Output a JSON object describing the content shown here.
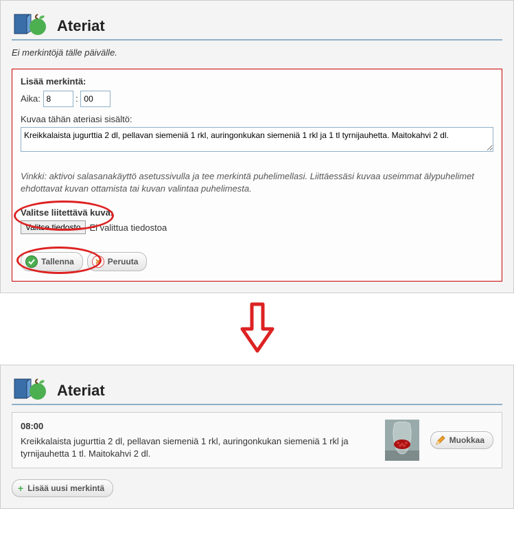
{
  "panel1": {
    "title": "Ateriat",
    "no_entries": "Ei merkintöjä tälle päivälle.",
    "form": {
      "heading": "Lisää merkintä:",
      "time_label": "Aika:",
      "hour": "8",
      "minute": "00",
      "time_sep": ":",
      "desc_label": "Kuvaa tähän ateriasi sisältö:",
      "desc_value": "Kreikkalaista jugurttia 2 dl, pellavan siemeniä 1 rkl, auringonkukan siemeniä 1 rkl ja 1 tl tyrnijauhetta. Maitokahvi 2 dl.",
      "hint": "Vinkki: aktivoi salasanakäyttö asetussivulla ja tee merkintä puhelimellasi. Liittäessäsi kuvaa useimmat älypuhelimet ehdottavat kuvan ottamista tai kuvan valintaa puhelimesta.",
      "file_heading": "Valitse liitettävä kuva:",
      "file_button": "Valitse tiedosto",
      "file_status": "Ei valittua tiedostoa",
      "save": "Tallenna",
      "cancel": "Peruuta"
    }
  },
  "panel2": {
    "title": "Ateriat",
    "entry": {
      "time": "08:00",
      "text": "Kreikkalaista jugurttia 2 dl, pellavan siemeniä 1 rkl, auringonkukan siemeniä 1 rkl ja tyrnijauhetta 1 tl. Maitokahvi 2 dl.",
      "edit": "Muokkaa"
    },
    "add_new": "Lisää uusi merkintä"
  }
}
